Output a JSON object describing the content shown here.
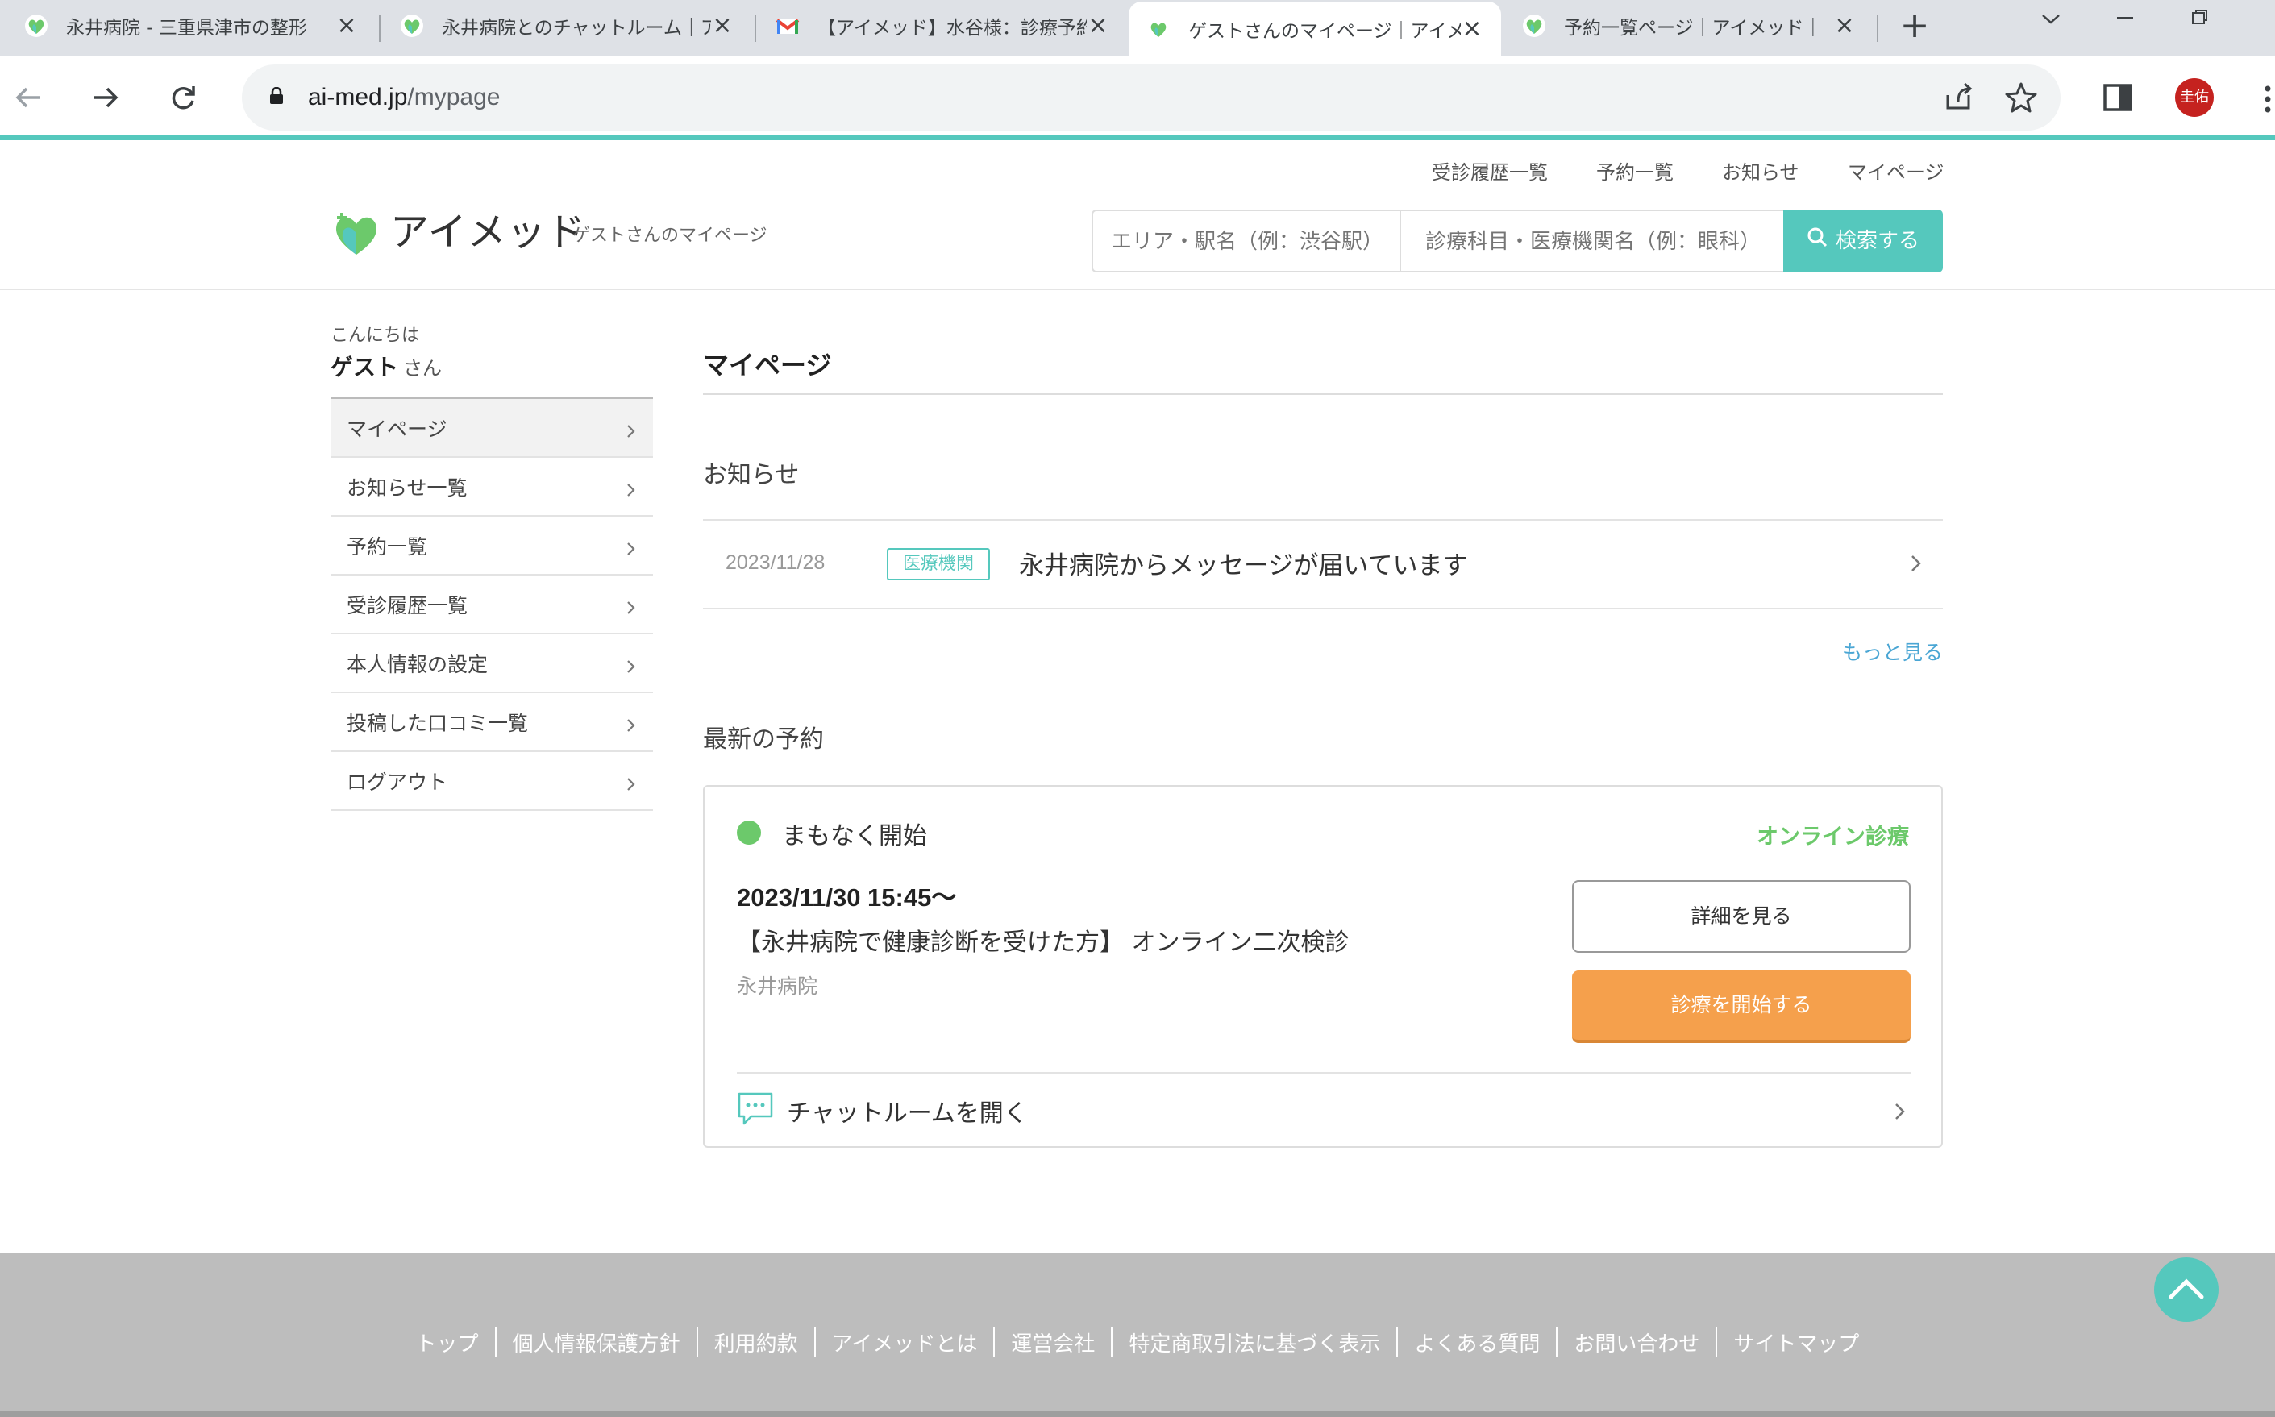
{
  "browser": {
    "tabs": [
      {
        "title": "永井病院 - 三重県津市の整形",
        "favicon": "aimed-heart-icon",
        "active": false
      },
      {
        "title": "永井病院とのチャットルーム｜ア",
        "favicon": "aimed-heart-icon",
        "active": false
      },
      {
        "title": "【アイメッド】水谷様：診療予約",
        "favicon": "gmail-icon",
        "active": false
      },
      {
        "title": "ゲストさんのマイページ｜アイメッ",
        "favicon": "aimed-heart-icon",
        "active": true
      },
      {
        "title": "予約一覧ページ｜アイメッド｜",
        "favicon": "aimed-heart-icon",
        "active": false
      }
    ],
    "close_glyph": "×",
    "new_tab_glyph": "+",
    "url_host": "ai-med.jp",
    "url_path": "/mypage",
    "profile_name": "圭佑"
  },
  "site": {
    "top_nav": [
      "受診履歴一覧",
      "予約一覧",
      "お知らせ",
      "マイページ"
    ],
    "logo_text": "アイメッド",
    "logo_sub": "ゲストさんのマイページ",
    "search": {
      "area_placeholder": "エリア・駅名（例：渋谷駅）",
      "dept_placeholder": "診療科目・医療機関名（例：眼科）",
      "button_label": "検索する"
    },
    "colors": {
      "accent": "#55c8bd",
      "status_green": "#6cc96b",
      "start_orange": "#f5a04c",
      "link_blue": "#4aa6d4"
    }
  },
  "sidebar": {
    "greeting": "こんにちは",
    "user_name": "ゲスト",
    "honorific": "さん",
    "items": [
      {
        "label": "マイページ",
        "current": true
      },
      {
        "label": "お知らせ一覧",
        "current": false
      },
      {
        "label": "予約一覧",
        "current": false
      },
      {
        "label": "受診履歴一覧",
        "current": false
      },
      {
        "label": "本人情報の設定",
        "current": false
      },
      {
        "label": "投稿した口コミ一覧",
        "current": false
      },
      {
        "label": "ログアウト",
        "current": false
      }
    ]
  },
  "main": {
    "title": "マイページ",
    "news": {
      "heading": "お知らせ",
      "items": [
        {
          "date": "2023/11/28",
          "badge": "医療機関",
          "text": "永井病院からメッセージが届いています"
        }
      ],
      "more_label": "もっと見る"
    },
    "reservation": {
      "heading": "最新の予約",
      "status": "まもなく開始",
      "type": "オンライン診療",
      "datetime": "2023/11/30 15:45〜",
      "description": "【永井病院で健康診断を受けた方】 オンライン二次検診",
      "hospital": "永井病院",
      "detail_button": "詳細を見る",
      "start_button": "診療を開始する",
      "chat_label": "チャットルームを開く"
    }
  },
  "footer": {
    "links": [
      "トップ",
      "個人情報保護方針",
      "利用約款",
      "アイメッドとは",
      "運営会社",
      "特定商取引法に基づく表示",
      "よくある質問",
      "お問い合わせ",
      "サイトマップ"
    ]
  }
}
